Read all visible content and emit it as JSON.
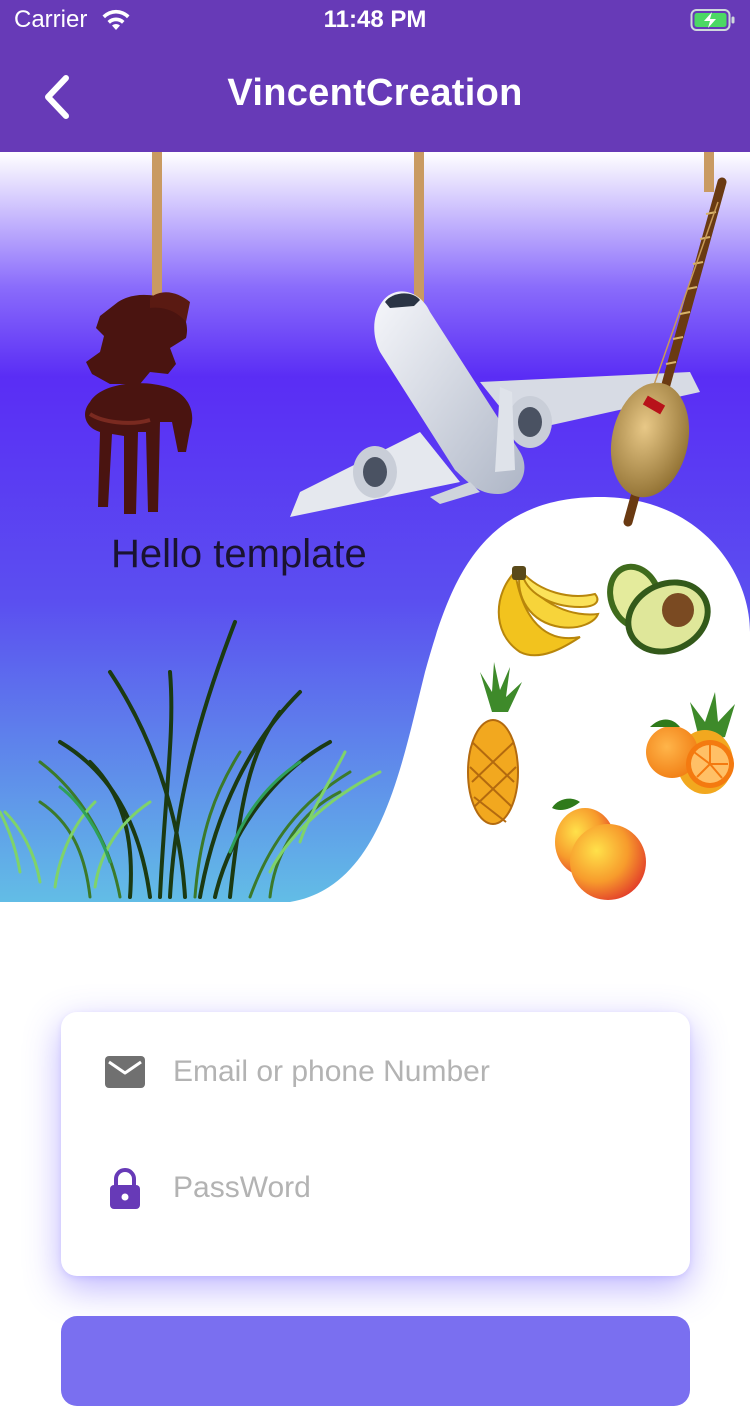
{
  "status_bar": {
    "carrier": "Carrier",
    "time": "11:48 PM",
    "wifi_icon": "wifi-icon",
    "battery_icon": "battery-charging-icon"
  },
  "app_bar": {
    "title": "VincentCreation",
    "back_icon": "chevron-left-icon",
    "background_color": "#673ab7"
  },
  "hero": {
    "heading": "Hello template",
    "illustrations": [
      "hanging-statue",
      "airplane",
      "hanging-kora",
      "grass",
      "banana",
      "avocado",
      "pineapple",
      "orange-pineapple",
      "mango"
    ]
  },
  "login_form": {
    "email": {
      "placeholder": "Email or phone Number",
      "value": "",
      "icon": "mail-icon"
    },
    "password": {
      "placeholder": "PassWord",
      "value": "",
      "icon": "lock-icon"
    }
  },
  "colors": {
    "accent": "#673ab7",
    "hero_gradient_top": "#ffffff",
    "hero_gradient_mid": "#5e2df5",
    "hero_gradient_bottom": "#63b6e8",
    "button": "#7a6ff0"
  }
}
